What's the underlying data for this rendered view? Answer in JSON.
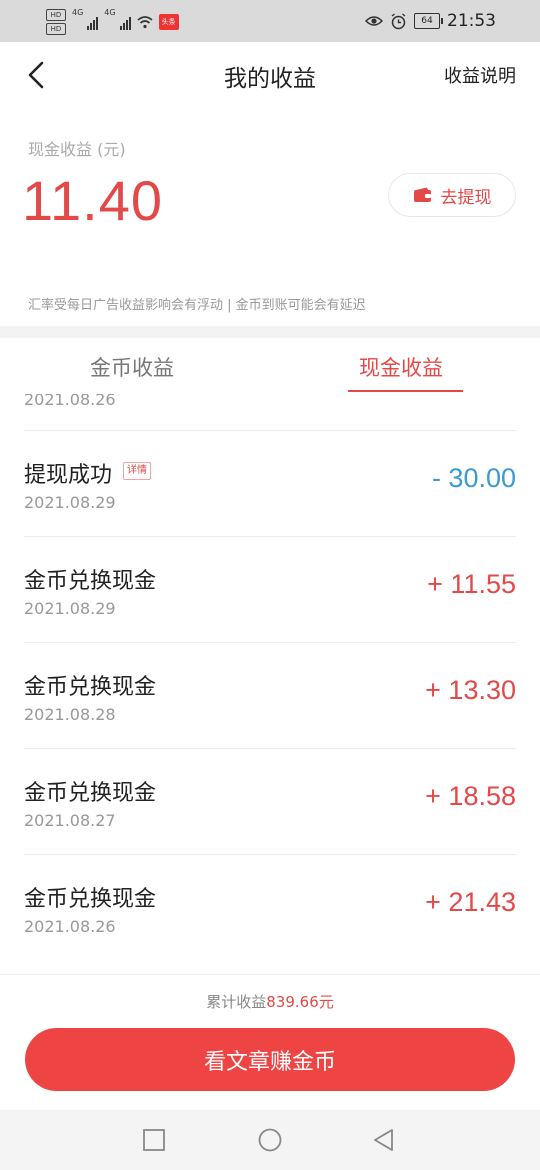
{
  "status_bar": {
    "hd1": "HD",
    "hd2": "HD",
    "net1": "4G",
    "net2": "4G",
    "app_badge": "头条",
    "battery": "64",
    "time": "21:53"
  },
  "header": {
    "title": "我的收益",
    "help_label": "收益说明"
  },
  "summary": {
    "cash_label": "现金收益 (元)",
    "cash_value": "11.40",
    "withdraw_label": "去提现",
    "note": "汇率受每日广告收益影响会有浮动 | 金币到账可能会有延迟"
  },
  "tabs": [
    {
      "label": "金币收益",
      "active": false
    },
    {
      "label": "现金收益",
      "active": true
    }
  ],
  "records": {
    "partial_date": "2021.08.26",
    "items": [
      {
        "name": "提现成功",
        "tag": "详情",
        "date": "2021.08.29",
        "amount": "- 30.00",
        "kind": "negative"
      },
      {
        "name": "金币兑换现金",
        "tag": "",
        "date": "2021.08.29",
        "amount": "+ 11.55",
        "kind": "positive"
      },
      {
        "name": "金币兑换现金",
        "tag": "",
        "date": "2021.08.28",
        "amount": "+ 13.30",
        "kind": "positive"
      },
      {
        "name": "金币兑换现金",
        "tag": "",
        "date": "2021.08.27",
        "amount": "+ 18.58",
        "kind": "positive"
      },
      {
        "name": "金币兑换现金",
        "tag": "",
        "date": "2021.08.26",
        "amount": "+ 21.43",
        "kind": "positive"
      }
    ]
  },
  "footer": {
    "total_prefix": "累计收益",
    "total_value": "839.66元",
    "cta_label": "看文章赚金币"
  },
  "colors": {
    "accent": "#e34948",
    "negative": "#3c9ad0",
    "cta": "#ee4444"
  },
  "icons": [
    "back-arrow-icon",
    "wallet-icon",
    "eye-icon",
    "alarm-icon",
    "wifi-icon",
    "signal-icon",
    "nav-square-icon",
    "nav-circle-icon",
    "nav-back-triangle-icon"
  ]
}
